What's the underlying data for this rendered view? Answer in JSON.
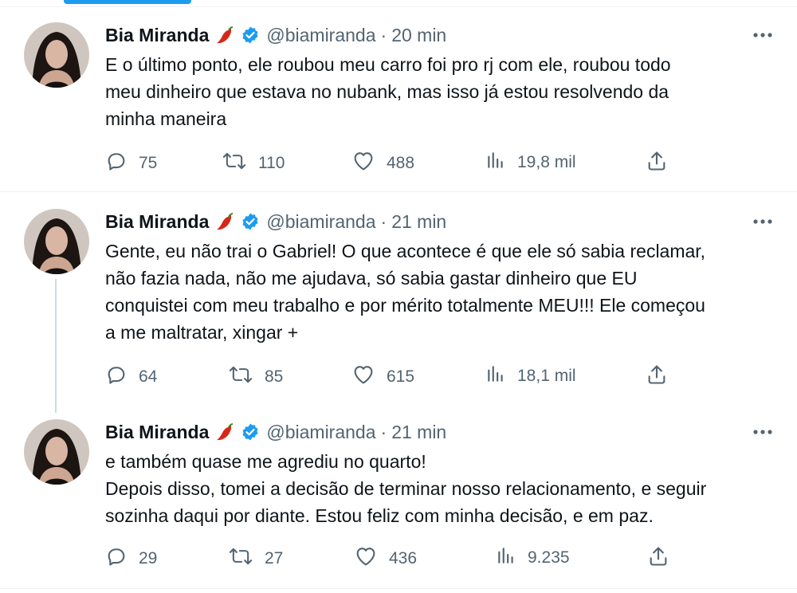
{
  "tweets": [
    {
      "author": "Bia Miranda",
      "handle": "@biamiranda",
      "separator": "·",
      "time": "20 min",
      "lines": [
        "E o último ponto, ele roubou meu carro foi pro rj com ele, roubou todo",
        "meu dinheiro que estava no nubank, mas isso já estou resolvendo da",
        "minha maneira"
      ],
      "replies": "75",
      "retweets": "110",
      "likes": "488",
      "views": "19,8 mil"
    },
    {
      "author": "Bia Miranda",
      "handle": "@biamiranda",
      "separator": "·",
      "time": "21 min",
      "lines": [
        "Gente, eu não trai o Gabriel! O que acontece é que ele só sabia reclamar,",
        "não fazia nada, não me ajudava, só sabia gastar dinheiro que EU",
        "conquistei com meu trabalho e por mérito totalmente MEU!!! Ele começou",
        "a me maltratar, xingar +"
      ],
      "replies": "64",
      "retweets": "85",
      "likes": "615",
      "views": "18,1 mil"
    },
    {
      "author": "Bia Miranda",
      "handle": "@biamiranda",
      "separator": "·",
      "time": "21 min",
      "lines": [
        "e também quase me agrediu no quarto!",
        "Depois disso, tomei a decisão de terminar nosso relacionamento, e seguir",
        "sozinha daqui por diante. Estou feliz com minha decisão, e em paz."
      ],
      "replies": "29",
      "retweets": "27",
      "likes": "436",
      "views": "9.235"
    }
  ],
  "icons": {
    "reply": "reply-icon",
    "retweet": "retweet-icon",
    "like": "heart-icon",
    "views": "views-icon",
    "share": "share-icon",
    "more": "more-icon",
    "verified": "verified-badge-icon",
    "emoji": "chili-pepper-icon"
  },
  "colors": {
    "accent": "#1d9bf0",
    "text": "#0f1419",
    "secondary": "#536471",
    "divider": "#eff3f4"
  }
}
